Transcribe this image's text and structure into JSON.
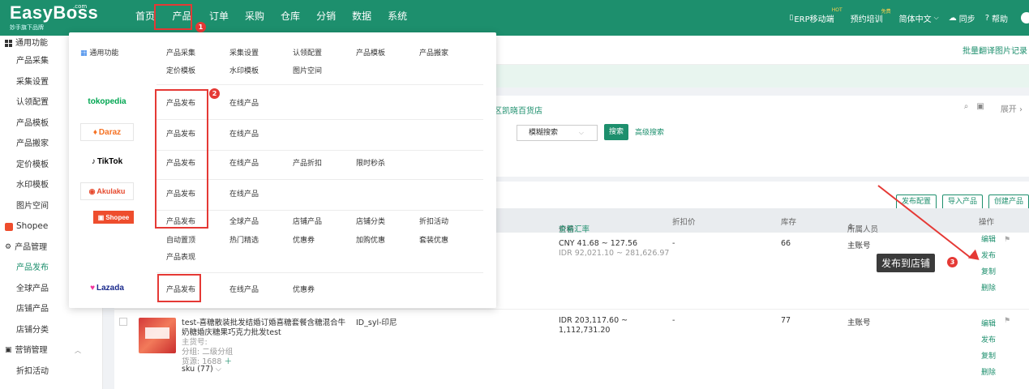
{
  "logo": {
    "main": "EasyBoss",
    "sup": ".com",
    "sub": "妙手旗下品牌"
  },
  "nav": [
    "首页",
    "产品",
    "订单",
    "采购",
    "仓库",
    "分销",
    "数据",
    "系统"
  ],
  "topright": {
    "erp": "ERP移动端",
    "hot": "HOT",
    "training": "预约培训",
    "free": "免费",
    "lang": "简体中文",
    "sync": "同步",
    "help": "帮助"
  },
  "sidebar": {
    "general_title": "通用功能",
    "general_items": [
      "产品采集",
      "采集设置",
      "认领配置",
      "产品模板",
      "产品搬家",
      "定价模板",
      "水印模板",
      "图片空间"
    ],
    "shopee_title": "Shopee",
    "product_mgmt": "产品管理",
    "product_items": [
      "产品发布",
      "全球产品",
      "店铺产品",
      "店铺分类"
    ],
    "marketing": "营销管理",
    "marketing_items": [
      "折扣活动"
    ]
  },
  "content": {
    "batch_link": "批量翻译图片记录",
    "store_text": "区凯晓百货店",
    "fr_expand": "展开",
    "select": "模糊搜索",
    "search_btn": "搜索",
    "adv_search": "高级搜索",
    "actions": [
      "发布配置",
      "导入产品",
      "创建产品"
    ],
    "table_headers": {
      "price": "价格",
      "exchange": "查看汇率",
      "discount": "折扣价",
      "stock": "库存",
      "owner": "所属人员",
      "ops": "操作"
    },
    "row1": {
      "price1": "CNY 41.68 ~ 127.56",
      "price2": "IDR 92,021.10 ~ 281,626.97",
      "discount": "-",
      "stock": "66",
      "owner": "主账号",
      "ops": [
        "编辑",
        "发布",
        "复制",
        "删除"
      ]
    },
    "row2": {
      "title_line1": "test-喜糖散装批发结婚订婚喜糖套餐含糖混合牛",
      "title_line2": "奶糖婚庆糖果巧克力批发test",
      "sku_code": "主货号:",
      "group": "分组:  二级分组",
      "source": "货源:  1688",
      "sku": "sku (77)",
      "id": "ID_syl-印尼",
      "price1": "IDR 203,117.60 ~",
      "price2": "1,112,731.20",
      "discount": "-",
      "stock": "77",
      "owner": "主账号",
      "ops": [
        "编辑",
        "发布",
        "复制",
        "删除"
      ]
    }
  },
  "dropdown": {
    "general_label": "通用功能",
    "general_items": [
      "产品采集",
      "采集设置",
      "认领配置",
      "产品模板",
      "产品搬家",
      "定价模板",
      "水印模板",
      "图片空间"
    ],
    "platforms": [
      {
        "brand": "tokopedia",
        "color": "#00a651",
        "items": [
          "产品发布",
          "在线产品"
        ]
      },
      {
        "brand": "Daraz",
        "color": "#f57224",
        "items": [
          "产品发布",
          "在线产品"
        ]
      },
      {
        "brand": "TikTok",
        "color": "#000000",
        "items": [
          "产品发布",
          "在线产品",
          "产品折扣",
          "限时秒杀"
        ]
      },
      {
        "brand": "Akulaku",
        "color": "#e64a2e",
        "items": [
          "产品发布",
          "在线产品"
        ]
      },
      {
        "brand": "Shopee",
        "color": "#ee4d2d",
        "items": [
          "产品发布",
          "全球产品",
          "店铺产品",
          "店铺分类",
          "折扣活动",
          "自动置顶",
          "热门精选",
          "优惠券",
          "加购优惠",
          "套装优惠",
          "产品表现"
        ]
      },
      {
        "brand": "Lazada",
        "color": "#1a2a8c",
        "items": [
          "产品发布",
          "在线产品",
          "优惠券"
        ]
      }
    ]
  },
  "annotations": {
    "n1": "1",
    "n2": "2",
    "n3": "3",
    "tooltip": "发布到店铺"
  }
}
